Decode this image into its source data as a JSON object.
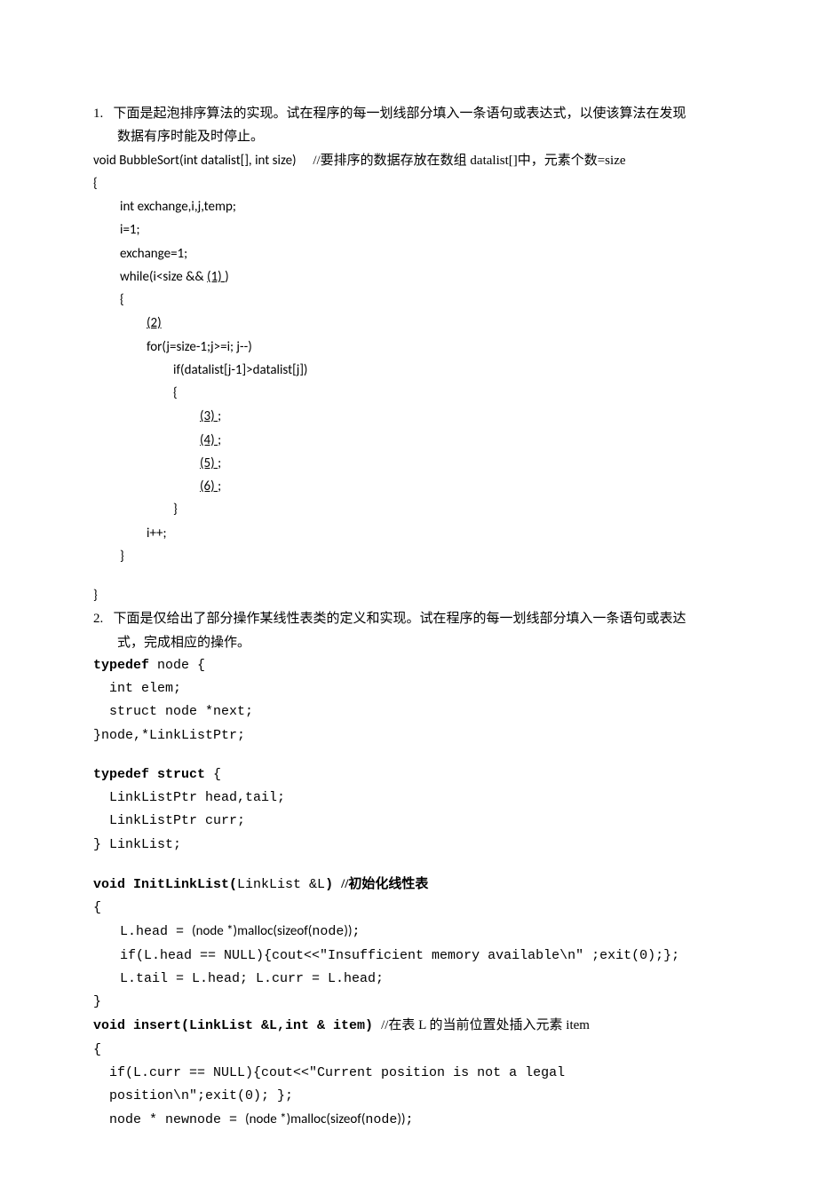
{
  "q1": {
    "num": "1.",
    "text_a": "下面是起泡排序算法的实现。试在程序的每一划线部分填入一条语句或表达式，以使该算法在发现",
    "text_b": "数据有序时能及时停止。",
    "code": {
      "sig": "void BubbleSort(int datalist[], int size)",
      "sig_comment": "//要排序的数据存放在数组 datalist[]中，元素个数=size",
      "l_open": "{",
      "decl": "int exchange,i,j,temp;",
      "a1": "i=1;",
      "a2": "exchange=1;",
      "while_pre": "while(i<size &&  ",
      "blank1": "    (1)             ",
      "while_post": ")",
      "l2_open": "{",
      "blank2": "         (2)            ",
      "for": "for(j=size-1;j>=i; j--)",
      "if": "if(datalist[j-1]>datalist[j])",
      "l3_open": "{",
      "blank3": "      (3)             ",
      "blank4": "      (4)             ",
      "blank5": "      (5)             ",
      "blank6": "       (6)              ",
      "semi": ";",
      "l3_close": "}",
      "inc": "i++;",
      "l2_close": "}",
      "l_close": "}"
    }
  },
  "q2": {
    "num": "2.",
    "text_a": "下面是仅给出了部分操作某线性表类的定义和实现。试在程序的每一划线部分填入一条语句或表达",
    "text_b": "式，完成相应的操作。",
    "code": {
      "td1_a": "typedef",
      "td1_b": " node {",
      "td1_c": "int elem;",
      "td1_d": "struct node *next;",
      "td1_e": "}node,*LinkListPtr;",
      "td2_a": "typedef struct",
      "td2_b": " {",
      "td2_c": "LinkListPtr head,tail;",
      "td2_d": "LinkListPtr curr;",
      "td2_e": "} LinkList;",
      "init_sig_a": "void InitLinkList(",
      "init_sig_b": "LinkList &L",
      "init_sig_c": ")",
      "init_sig_comment": "//初始化线性表",
      "init_open": "{",
      "init_l1a": "L.head = ",
      "init_l1b": "(node *)malloc(sizeof(",
      "init_l1c": "node",
      "init_l1d": "))",
      "init_l1e": ";",
      "init_l2": "if(L.head == NULL){cout<<\"Insufficient memory available\\n\" ;exit(0);};",
      "init_l3": "L.tail = L.head; L.curr = L.head;",
      "init_close": "}",
      "ins_sig_a": "void insert(LinkList &L,int & item)",
      "ins_sig_comment": "//在表 L 的当前位置处插入元素 item",
      "ins_open": "{",
      "ins_l1": "if(L.curr == NULL){cout<<\"Current position is not a legal position\\n\";exit(0);  };",
      "ins_l2a": "node * newnode = ",
      "ins_l2b": "(node *)malloc(sizeof(",
      "ins_l2c": "node",
      "ins_l2d": "))",
      "ins_l2e": ";"
    }
  }
}
